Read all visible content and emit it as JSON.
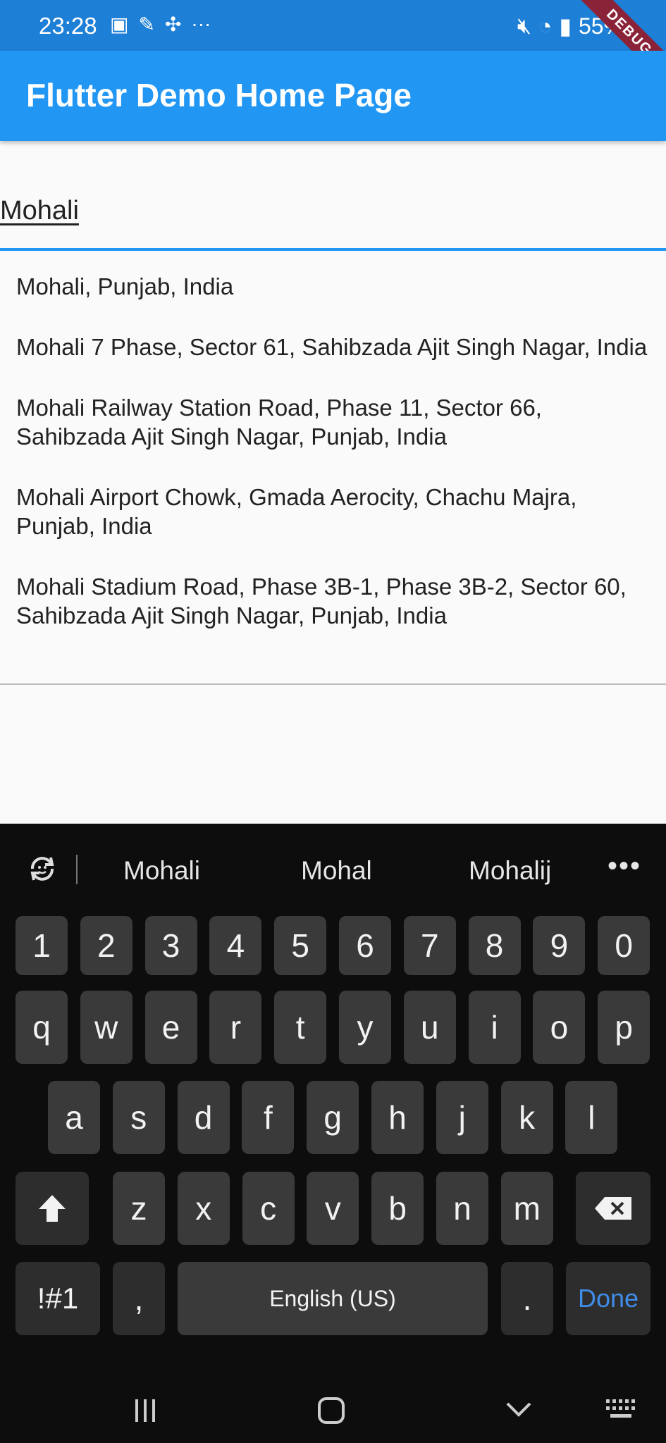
{
  "status_bar": {
    "time": "23:28",
    "battery": "55%",
    "debug_label": "DEBUG"
  },
  "app_bar": {
    "title": "Flutter Demo Home Page"
  },
  "search": {
    "value": "Mohali"
  },
  "suggestions": [
    "Mohali, Punjab, India",
    "Mohali 7 Phase, Sector 61, Sahibzada Ajit Singh Nagar, India",
    "Mohali Railway Station Road, Phase 11, Sector 66, Sahibzada Ajit Singh Nagar, Punjab, India",
    "Mohali Airport Chowk, Gmada Aerocity, Chachu Majra, Punjab, India",
    "Mohali Stadium Road, Phase 3B-1, Phase 3B-2, Sector 60, Sahibzada Ajit Singh Nagar, Punjab, India"
  ],
  "keyboard": {
    "predictions": [
      "Mohali",
      "Mohal",
      "Mohalij"
    ],
    "row_numbers": [
      "1",
      "2",
      "3",
      "4",
      "5",
      "6",
      "7",
      "8",
      "9",
      "0"
    ],
    "row_top": [
      "q",
      "w",
      "e",
      "r",
      "t",
      "y",
      "u",
      "i",
      "o",
      "p"
    ],
    "row_middle": [
      "a",
      "s",
      "d",
      "f",
      "g",
      "h",
      "j",
      "k",
      "l"
    ],
    "row_bottom": [
      "z",
      "x",
      "c",
      "v",
      "b",
      "n",
      "m"
    ],
    "symbols_label": "!#1",
    "comma_label": ",",
    "space_label": "English (US)",
    "period_label": ".",
    "done_label": "Done"
  },
  "colors": {
    "app_bar": "#2196f3",
    "status_bar": "#1e7fd6",
    "accent": "#3f8de9",
    "keyboard_bg": "#0d0d0d",
    "key_bg": "#3a3a3a"
  }
}
